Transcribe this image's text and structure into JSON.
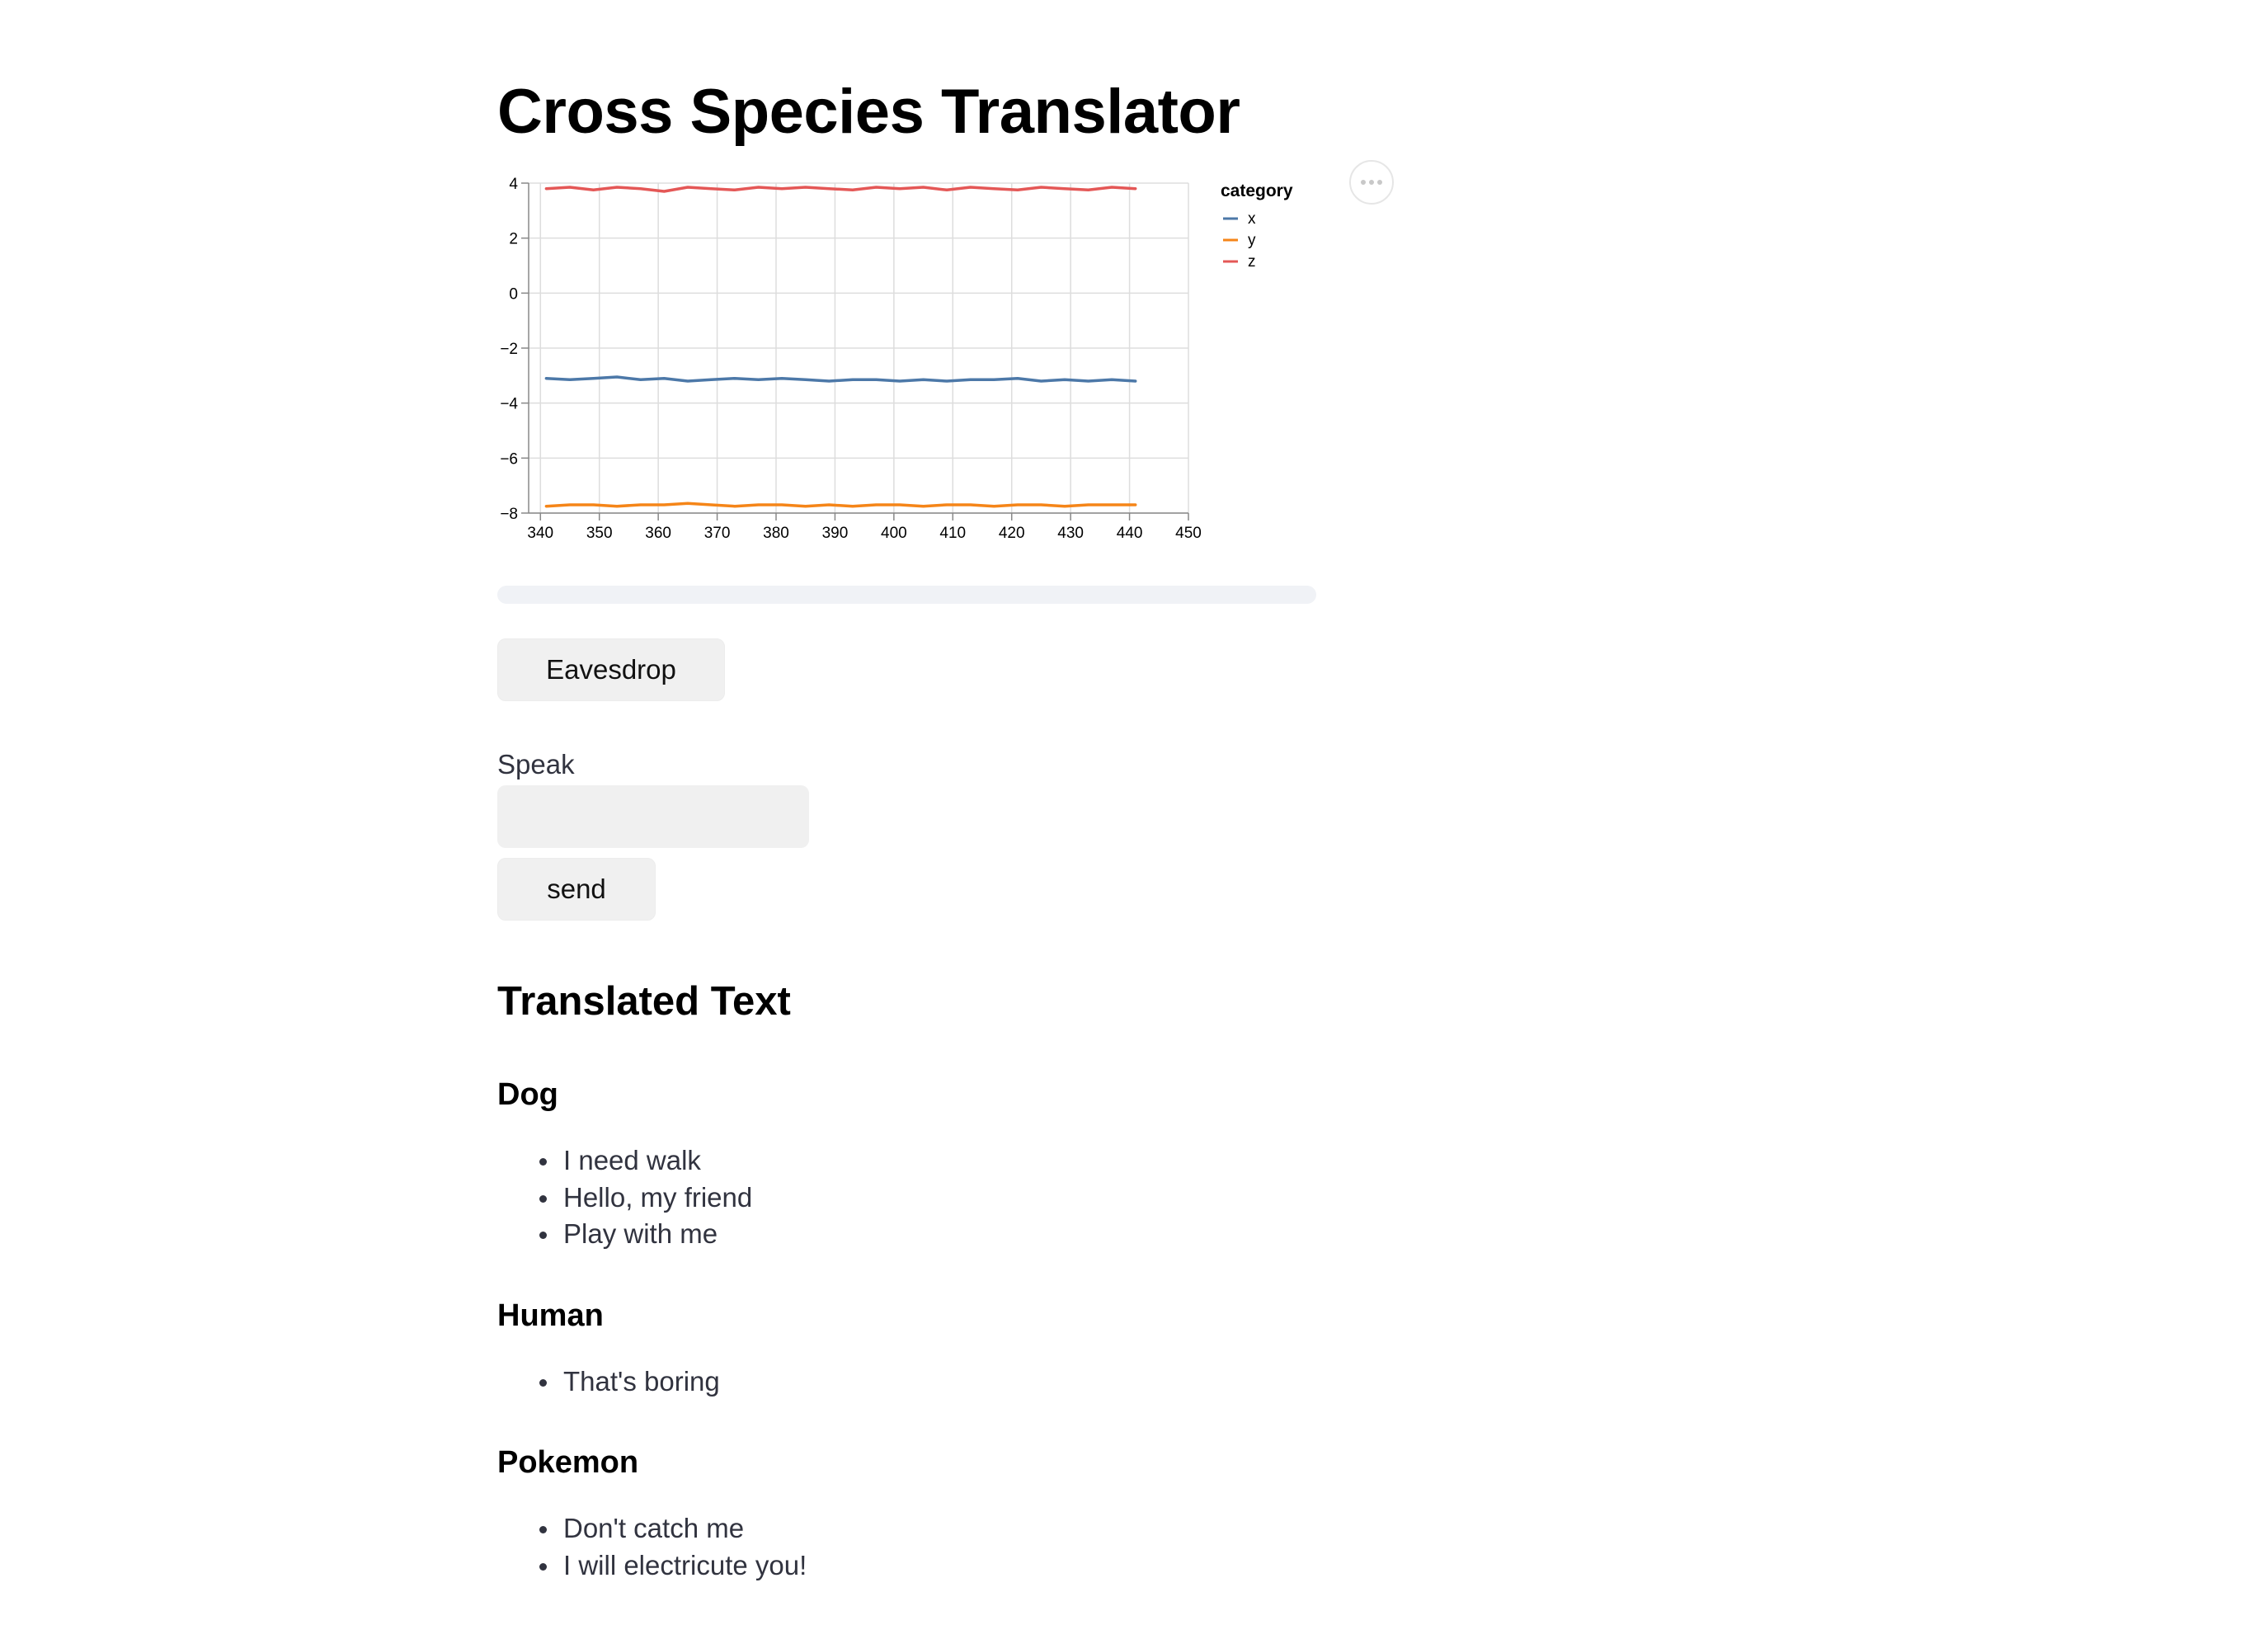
{
  "title": "Cross Species Translator",
  "chart_data": {
    "type": "line",
    "xlabel": "",
    "ylabel": "",
    "xlim": [
      338,
      450
    ],
    "ylim": [
      -8,
      4
    ],
    "xticks": [
      340,
      350,
      360,
      370,
      380,
      390,
      400,
      410,
      420,
      430,
      440,
      450
    ],
    "yticks": [
      4,
      2,
      0,
      -2,
      -4,
      -6,
      -8
    ],
    "ytick_labels": [
      "4",
      "2",
      "0",
      "−2",
      "−4",
      "−6",
      "−8"
    ],
    "grid": true,
    "legend": {
      "title": "category",
      "position": "right"
    },
    "series": [
      {
        "name": "x",
        "color": "#4c78a8",
        "x": [
          341,
          345,
          349,
          353,
          357,
          361,
          365,
          369,
          373,
          377,
          381,
          385,
          389,
          393,
          397,
          401,
          405,
          409,
          413,
          417,
          421,
          425,
          429,
          433,
          437,
          441
        ],
        "y": [
          -3.1,
          -3.15,
          -3.1,
          -3.05,
          -3.15,
          -3.1,
          -3.2,
          -3.15,
          -3.1,
          -3.15,
          -3.1,
          -3.15,
          -3.2,
          -3.15,
          -3.15,
          -3.2,
          -3.15,
          -3.2,
          -3.15,
          -3.15,
          -3.1,
          -3.2,
          -3.15,
          -3.2,
          -3.15,
          -3.2
        ]
      },
      {
        "name": "y",
        "color": "#f58518",
        "x": [
          341,
          345,
          349,
          353,
          357,
          361,
          365,
          369,
          373,
          377,
          381,
          385,
          389,
          393,
          397,
          401,
          405,
          409,
          413,
          417,
          421,
          425,
          429,
          433,
          437,
          441
        ],
        "y": [
          -7.75,
          -7.7,
          -7.7,
          -7.75,
          -7.7,
          -7.7,
          -7.65,
          -7.7,
          -7.75,
          -7.7,
          -7.7,
          -7.75,
          -7.7,
          -7.75,
          -7.7,
          -7.7,
          -7.75,
          -7.7,
          -7.7,
          -7.75,
          -7.7,
          -7.7,
          -7.75,
          -7.7,
          -7.7,
          -7.7
        ]
      },
      {
        "name": "z",
        "color": "#e45756",
        "x": [
          341,
          345,
          349,
          353,
          357,
          361,
          365,
          369,
          373,
          377,
          381,
          385,
          389,
          393,
          397,
          401,
          405,
          409,
          413,
          417,
          421,
          425,
          429,
          433,
          437,
          441
        ],
        "y": [
          3.8,
          3.85,
          3.75,
          3.85,
          3.8,
          3.7,
          3.85,
          3.8,
          3.75,
          3.85,
          3.8,
          3.85,
          3.8,
          3.75,
          3.85,
          3.8,
          3.85,
          3.75,
          3.85,
          3.8,
          3.75,
          3.85,
          3.8,
          3.75,
          3.85,
          3.8
        ]
      }
    ]
  },
  "progress": {
    "value": 0
  },
  "controls": {
    "eavesdrop_label": "Eavesdrop",
    "speak_label": "Speak",
    "speak_value": "",
    "send_label": "send"
  },
  "translated": {
    "heading": "Translated Text",
    "groups": [
      {
        "title": "Dog",
        "messages": [
          "I need walk",
          "Hello, my friend",
          "Play with me"
        ]
      },
      {
        "title": "Human",
        "messages": [
          "That's boring"
        ]
      },
      {
        "title": "Pokemon",
        "messages": [
          "Don't catch me",
          "I will electricute you!"
        ]
      }
    ]
  },
  "icons": {
    "chart_menu": "more-horizontal-icon"
  }
}
